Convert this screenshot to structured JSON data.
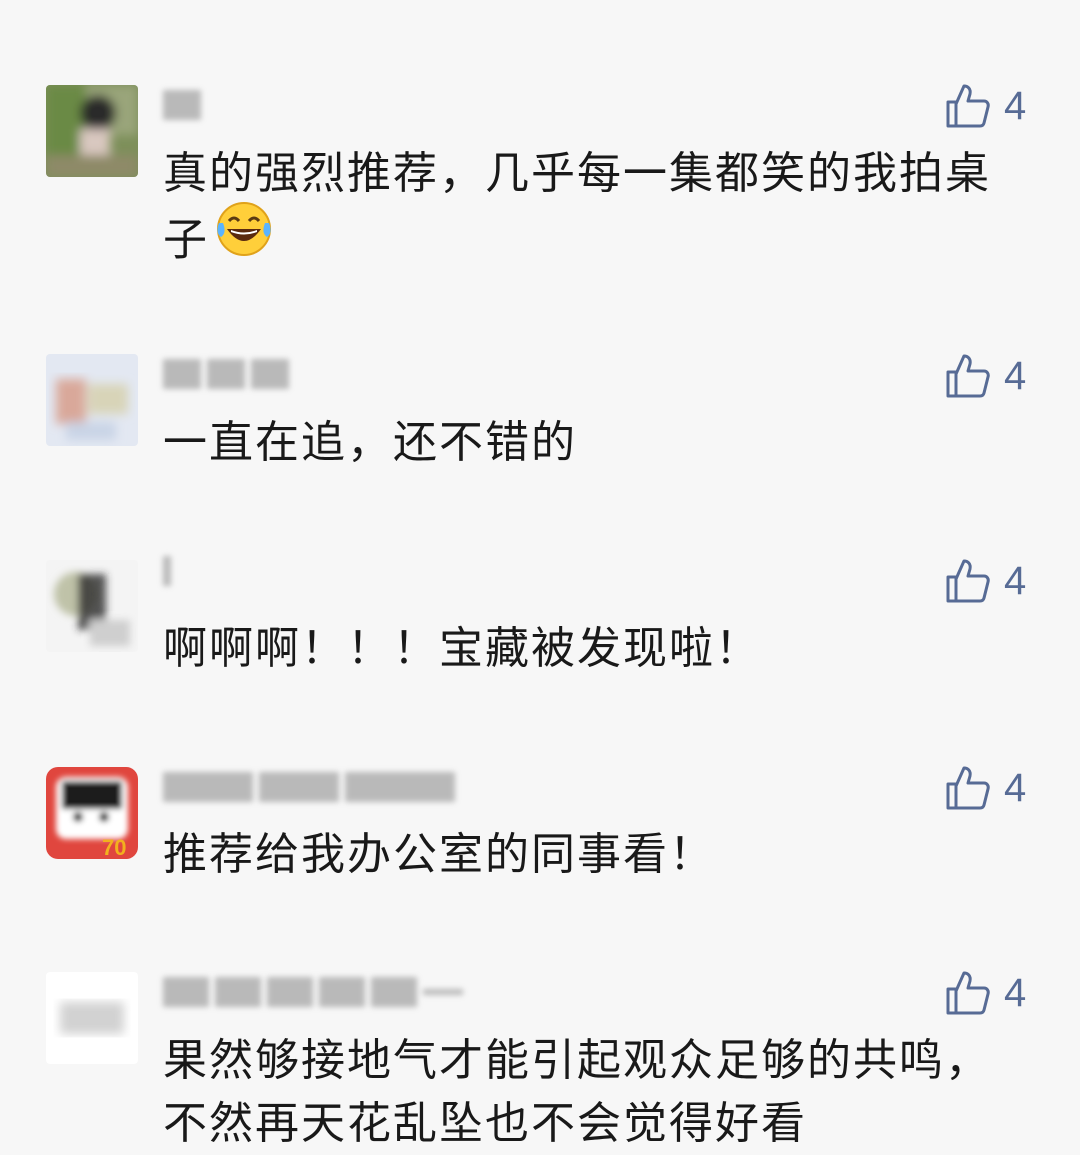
{
  "comments": [
    {
      "nickname": "",
      "likes": "4",
      "content": "真的强烈推荐，几乎每一集都笑的我拍桌子",
      "emoji": "laughing-tears-emoji"
    },
    {
      "nickname": "",
      "likes": "4",
      "content": "一直在追，还不错的"
    },
    {
      "nickname": "",
      "likes": "4",
      "content": "啊啊啊！！！宝藏被发现啦！"
    },
    {
      "nickname": "",
      "likes": "4",
      "content": "推荐给我办公室的同事看！"
    },
    {
      "nickname": "",
      "likes": "4",
      "content": "果然够接地气才能引起观众足够的共鸣，不然再天花乱坠也不会觉得好看"
    }
  ],
  "colors": {
    "background": "#f7f7f7",
    "like_blue": "#576b95",
    "text": "#191919"
  },
  "icons": {
    "like": "thumbs-up-outline-icon"
  }
}
